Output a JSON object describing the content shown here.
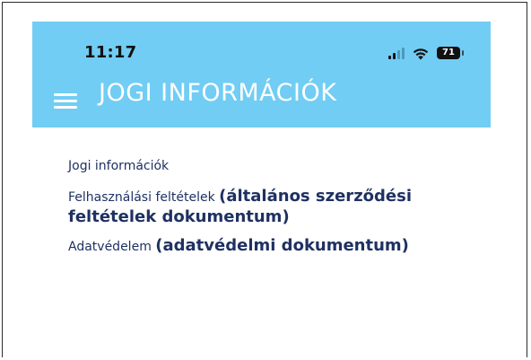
{
  "status_bar": {
    "time": "11:17",
    "battery_level": "71",
    "icons": [
      "signal-icon",
      "wifi-icon",
      "battery-icon"
    ]
  },
  "header": {
    "title": "JOGI INFORMÁCIÓK",
    "menu_icon": "menu-icon",
    "background_color": "#71cdf4"
  },
  "content": {
    "heading": "Jogi információk",
    "links": [
      {
        "label": "Felhasználási feltételek",
        "document": "(általános szerződési feltételek dokumentum)"
      },
      {
        "label": "Adatvédelem",
        "document": "(adatvédelmi dokumentum)"
      }
    ],
    "text_color": "#1f3163"
  }
}
